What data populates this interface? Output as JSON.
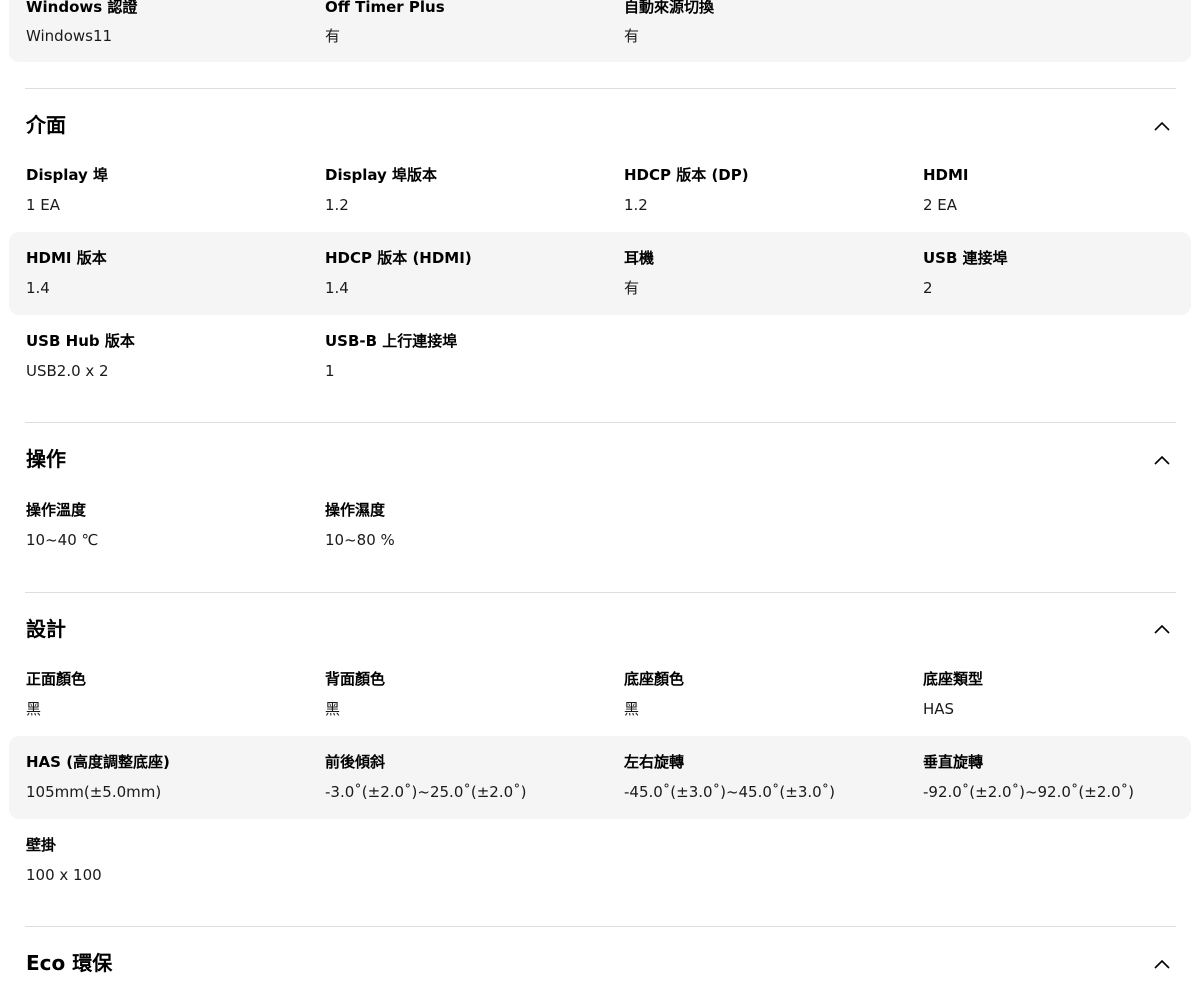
{
  "top_row": [
    {
      "label": "Windows 認證",
      "value": "Windows11"
    },
    {
      "label": "Off Timer Plus",
      "value": "有"
    },
    {
      "label": "自動來源切換",
      "value": "有"
    }
  ],
  "sections": [
    {
      "title": "介面",
      "rows": [
        [
          {
            "label": "Display 埠",
            "value": "1 EA"
          },
          {
            "label": "Display 埠版本",
            "value": "1.2"
          },
          {
            "label": "HDCP 版本 (DP)",
            "value": "1.2"
          },
          {
            "label": "HDMI",
            "value": "2 EA"
          }
        ],
        [
          {
            "label": "HDMI 版本",
            "value": "1.4"
          },
          {
            "label": "HDCP 版本 (HDMI)",
            "value": "1.4"
          },
          {
            "label": "耳機",
            "value": "有"
          },
          {
            "label": "USB 連接埠",
            "value": "2"
          }
        ],
        [
          {
            "label": "USB Hub 版本",
            "value": "USB2.0 x 2"
          },
          {
            "label": "USB-B 上行連接埠",
            "value": "1"
          }
        ]
      ]
    },
    {
      "title": "操作",
      "rows": [
        [
          {
            "label": "操作溫度",
            "value": "10~40 ℃"
          },
          {
            "label": "操作濕度",
            "value": "10~80 %"
          }
        ]
      ]
    },
    {
      "title": "設計",
      "rows": [
        [
          {
            "label": "正面顏色",
            "value": "黑"
          },
          {
            "label": "背面顏色",
            "value": "黑"
          },
          {
            "label": "底座顏色",
            "value": "黑"
          },
          {
            "label": "底座類型",
            "value": "HAS"
          }
        ],
        [
          {
            "label": "HAS (高度調整底座)",
            "value": "105mm(±5.0mm)"
          },
          {
            "label": "前後傾斜",
            "value": "-3.0˚(±2.0˚)~25.0˚(±2.0˚)"
          },
          {
            "label": "左右旋轉",
            "value": "-45.0˚(±3.0˚)~45.0˚(±3.0˚)"
          },
          {
            "label": "垂直旋轉",
            "value": "-92.0˚(±2.0˚)~92.0˚(±2.0˚)"
          }
        ],
        [
          {
            "label": "壁掛",
            "value": "100 x 100"
          }
        ]
      ]
    },
    {
      "title": "Eco 環保",
      "rows": []
    }
  ],
  "icons": {
    "collapse": "chevron-up-icon"
  },
  "colors": {
    "shaded_row": "#f5f5f5",
    "divider": "#dddddd"
  }
}
